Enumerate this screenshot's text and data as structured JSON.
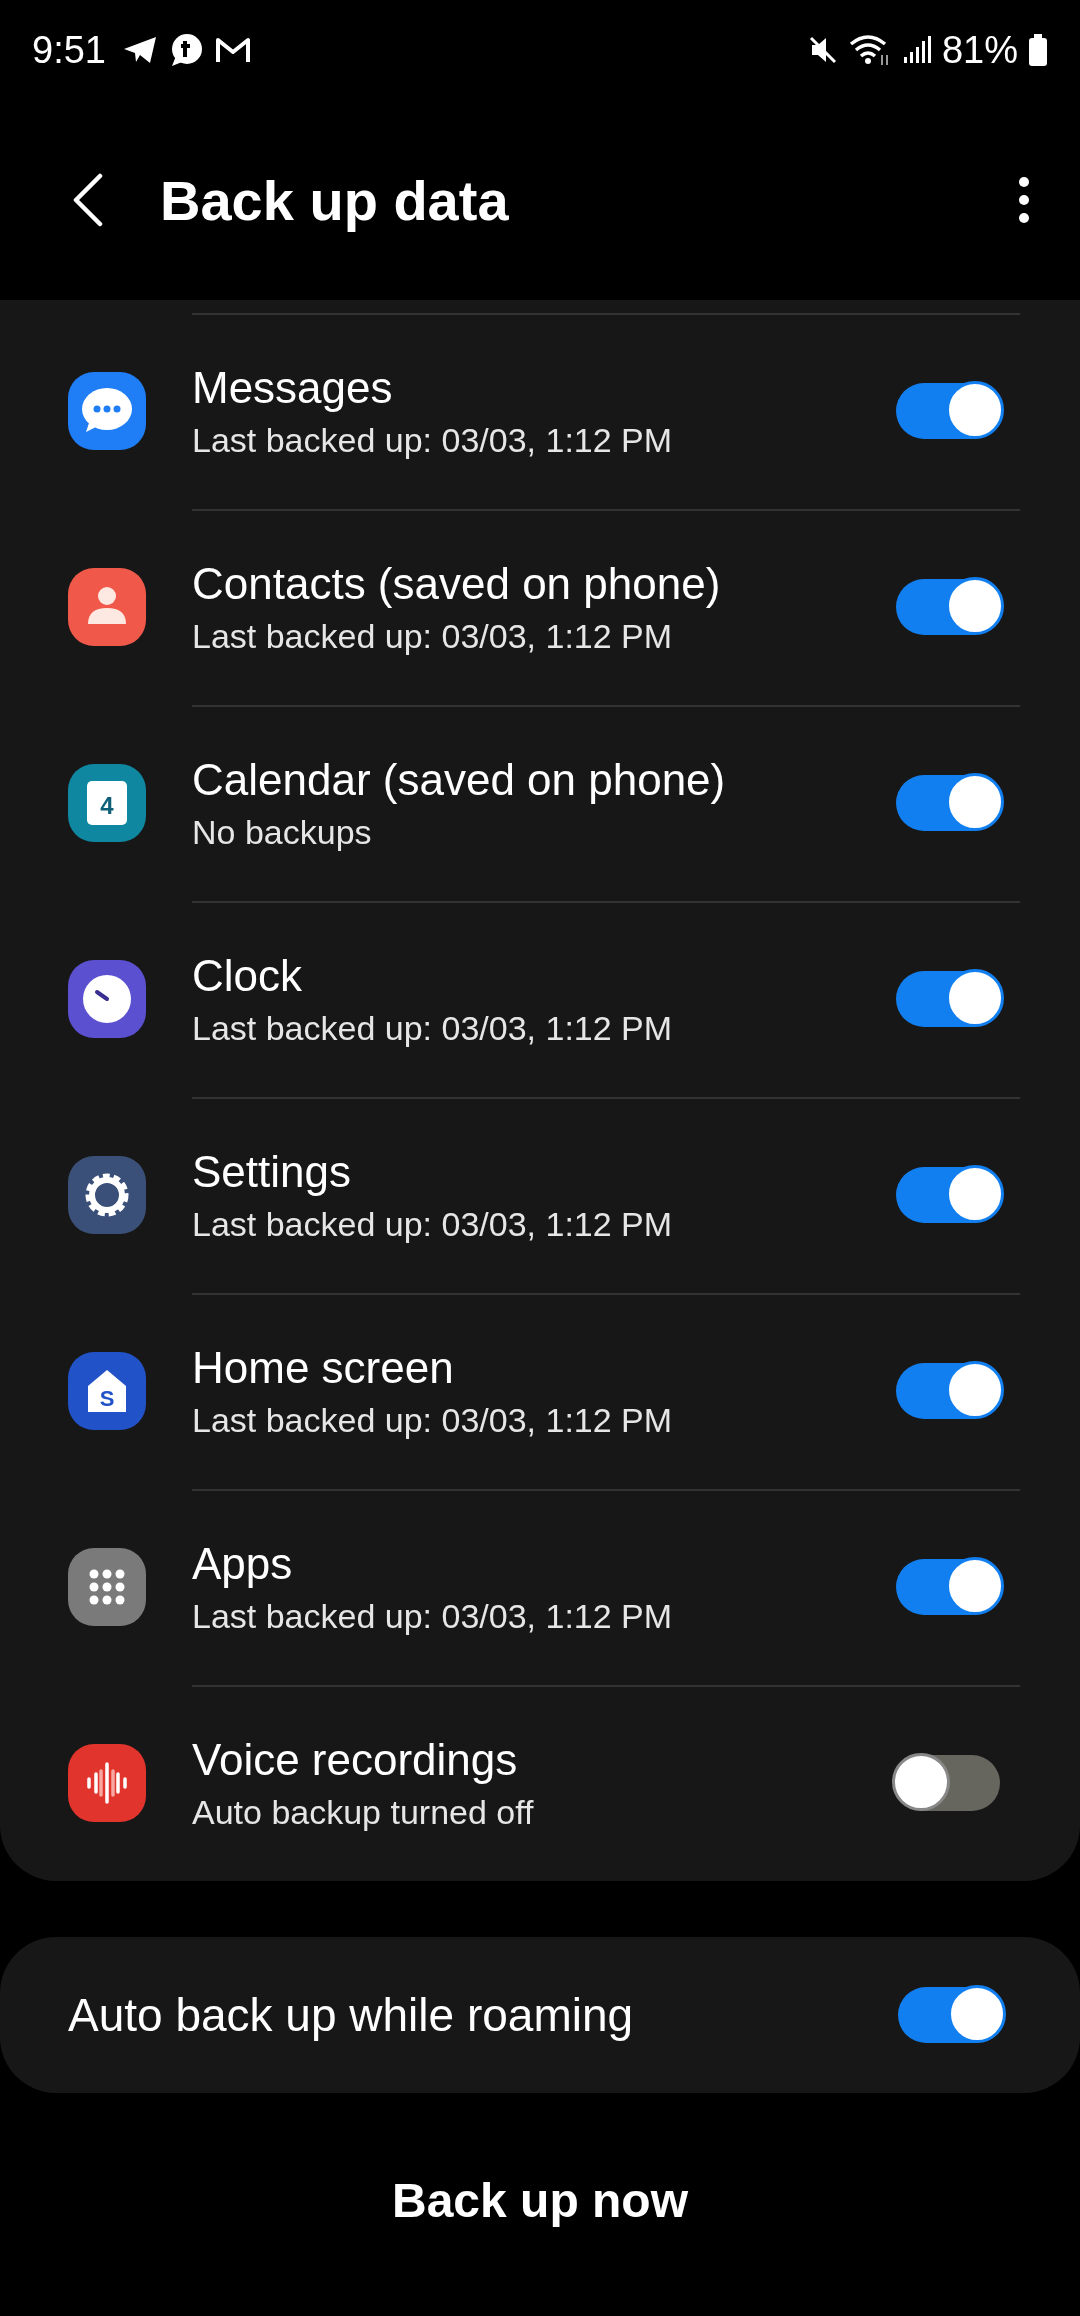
{
  "status_bar": {
    "time": "9:51",
    "battery": "81%"
  },
  "header": {
    "title": "Back up data"
  },
  "items": [
    {
      "kind": "messages",
      "name": "Messages",
      "subtitle": "Last backed up: 03/03, 1:12 PM",
      "on": true
    },
    {
      "kind": "contacts",
      "name": "Contacts (saved on phone)",
      "subtitle": "Last backed up: 03/03, 1:12 PM",
      "on": true
    },
    {
      "kind": "calendar",
      "name": "Calendar (saved on phone)",
      "subtitle": "No backups",
      "on": true,
      "icon_text": "4"
    },
    {
      "kind": "clock",
      "name": "Clock",
      "subtitle": "Last backed up: 03/03, 1:12 PM",
      "on": true
    },
    {
      "kind": "settings",
      "name": "Settings",
      "subtitle": "Last backed up: 03/03, 1:12 PM",
      "on": true
    },
    {
      "kind": "home",
      "name": "Home screen",
      "subtitle": "Last backed up: 03/03, 1:12 PM",
      "on": true,
      "icon_text": "S"
    },
    {
      "kind": "apps",
      "name": "Apps",
      "subtitle": "Last backed up: 03/03, 1:12 PM",
      "on": true
    },
    {
      "kind": "voice",
      "name": "Voice recordings",
      "subtitle": "Auto backup turned off",
      "on": false
    }
  ],
  "roaming": {
    "label": "Auto back up while roaming",
    "on": true
  },
  "action": {
    "label": "Back up now"
  }
}
